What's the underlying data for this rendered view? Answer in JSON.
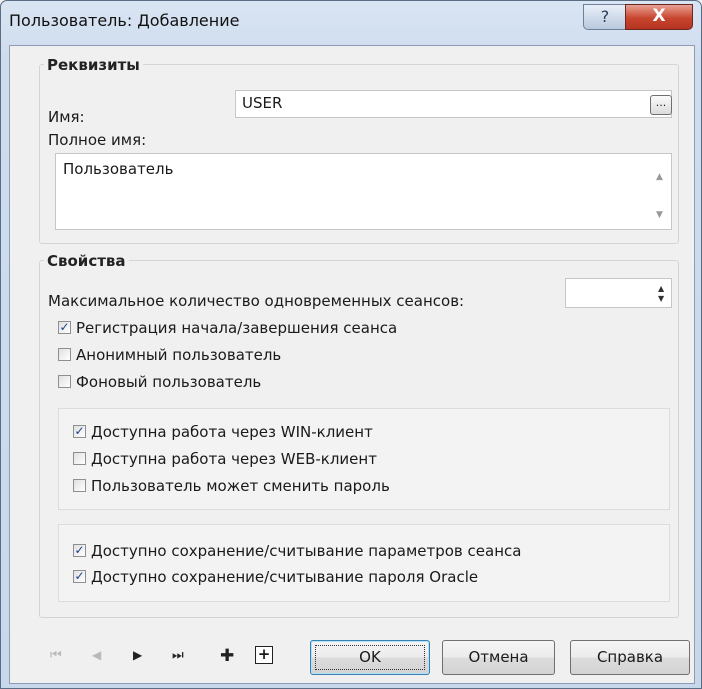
{
  "window": {
    "title": "Пользователь: Добавление",
    "help_glyph": "?",
    "close_glyph": "X"
  },
  "requisites": {
    "title": "Реквизиты",
    "name_label": "Имя:",
    "name_value": "USER",
    "name_button": "...",
    "fullname_label": "Полное имя:",
    "fullname_value": "Пользователь"
  },
  "properties": {
    "title": "Свойства",
    "max_sessions_label": "Максимальное количество одновременных сеансов:",
    "max_sessions_value": "",
    "checkboxes": [
      {
        "label": "Регистрация начала/завершения сеанса",
        "checked": true
      },
      {
        "label": "Анонимный пользователь",
        "checked": false
      },
      {
        "label": "Фоновый пользователь",
        "checked": false
      }
    ],
    "access_checkboxes": [
      {
        "label": "Доступна работа через WIN-клиент",
        "checked": true
      },
      {
        "label": "Доступна работа через WEB-клиент",
        "checked": false
      },
      {
        "label": "Пользователь может сменить пароль",
        "checked": false
      }
    ],
    "save_checkboxes": [
      {
        "label": "Доступно сохранение/считывание параметров сеанса",
        "checked": true
      },
      {
        "label": "Доступно сохранение/считывание пароля Oracle",
        "checked": true
      }
    ]
  },
  "nav": {
    "first": "⏮",
    "prev": "◀",
    "next": "▶",
    "last": "⏭",
    "add": "✚",
    "add_boxed": "+"
  },
  "buttons": {
    "ok": "OK",
    "cancel": "Отмена",
    "help": "Справка"
  },
  "check_mark": "✓"
}
